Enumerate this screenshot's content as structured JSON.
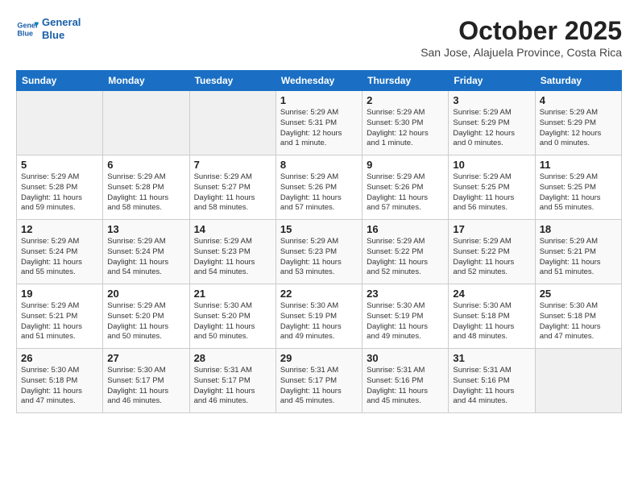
{
  "logo": {
    "line1": "General",
    "line2": "Blue"
  },
  "title": "October 2025",
  "subtitle": "San Jose, Alajuela Province, Costa Rica",
  "headers": [
    "Sunday",
    "Monday",
    "Tuesday",
    "Wednesday",
    "Thursday",
    "Friday",
    "Saturday"
  ],
  "weeks": [
    [
      {
        "day": "",
        "info": ""
      },
      {
        "day": "",
        "info": ""
      },
      {
        "day": "",
        "info": ""
      },
      {
        "day": "1",
        "info": "Sunrise: 5:29 AM\nSunset: 5:31 PM\nDaylight: 12 hours\nand 1 minute."
      },
      {
        "day": "2",
        "info": "Sunrise: 5:29 AM\nSunset: 5:30 PM\nDaylight: 12 hours\nand 1 minute."
      },
      {
        "day": "3",
        "info": "Sunrise: 5:29 AM\nSunset: 5:29 PM\nDaylight: 12 hours\nand 0 minutes."
      },
      {
        "day": "4",
        "info": "Sunrise: 5:29 AM\nSunset: 5:29 PM\nDaylight: 12 hours\nand 0 minutes."
      }
    ],
    [
      {
        "day": "5",
        "info": "Sunrise: 5:29 AM\nSunset: 5:28 PM\nDaylight: 11 hours\nand 59 minutes."
      },
      {
        "day": "6",
        "info": "Sunrise: 5:29 AM\nSunset: 5:28 PM\nDaylight: 11 hours\nand 58 minutes."
      },
      {
        "day": "7",
        "info": "Sunrise: 5:29 AM\nSunset: 5:27 PM\nDaylight: 11 hours\nand 58 minutes."
      },
      {
        "day": "8",
        "info": "Sunrise: 5:29 AM\nSunset: 5:26 PM\nDaylight: 11 hours\nand 57 minutes."
      },
      {
        "day": "9",
        "info": "Sunrise: 5:29 AM\nSunset: 5:26 PM\nDaylight: 11 hours\nand 57 minutes."
      },
      {
        "day": "10",
        "info": "Sunrise: 5:29 AM\nSunset: 5:25 PM\nDaylight: 11 hours\nand 56 minutes."
      },
      {
        "day": "11",
        "info": "Sunrise: 5:29 AM\nSunset: 5:25 PM\nDaylight: 11 hours\nand 55 minutes."
      }
    ],
    [
      {
        "day": "12",
        "info": "Sunrise: 5:29 AM\nSunset: 5:24 PM\nDaylight: 11 hours\nand 55 minutes."
      },
      {
        "day": "13",
        "info": "Sunrise: 5:29 AM\nSunset: 5:24 PM\nDaylight: 11 hours\nand 54 minutes."
      },
      {
        "day": "14",
        "info": "Sunrise: 5:29 AM\nSunset: 5:23 PM\nDaylight: 11 hours\nand 54 minutes."
      },
      {
        "day": "15",
        "info": "Sunrise: 5:29 AM\nSunset: 5:23 PM\nDaylight: 11 hours\nand 53 minutes."
      },
      {
        "day": "16",
        "info": "Sunrise: 5:29 AM\nSunset: 5:22 PM\nDaylight: 11 hours\nand 52 minutes."
      },
      {
        "day": "17",
        "info": "Sunrise: 5:29 AM\nSunset: 5:22 PM\nDaylight: 11 hours\nand 52 minutes."
      },
      {
        "day": "18",
        "info": "Sunrise: 5:29 AM\nSunset: 5:21 PM\nDaylight: 11 hours\nand 51 minutes."
      }
    ],
    [
      {
        "day": "19",
        "info": "Sunrise: 5:29 AM\nSunset: 5:21 PM\nDaylight: 11 hours\nand 51 minutes."
      },
      {
        "day": "20",
        "info": "Sunrise: 5:29 AM\nSunset: 5:20 PM\nDaylight: 11 hours\nand 50 minutes."
      },
      {
        "day": "21",
        "info": "Sunrise: 5:30 AM\nSunset: 5:20 PM\nDaylight: 11 hours\nand 50 minutes."
      },
      {
        "day": "22",
        "info": "Sunrise: 5:30 AM\nSunset: 5:19 PM\nDaylight: 11 hours\nand 49 minutes."
      },
      {
        "day": "23",
        "info": "Sunrise: 5:30 AM\nSunset: 5:19 PM\nDaylight: 11 hours\nand 49 minutes."
      },
      {
        "day": "24",
        "info": "Sunrise: 5:30 AM\nSunset: 5:18 PM\nDaylight: 11 hours\nand 48 minutes."
      },
      {
        "day": "25",
        "info": "Sunrise: 5:30 AM\nSunset: 5:18 PM\nDaylight: 11 hours\nand 47 minutes."
      }
    ],
    [
      {
        "day": "26",
        "info": "Sunrise: 5:30 AM\nSunset: 5:18 PM\nDaylight: 11 hours\nand 47 minutes."
      },
      {
        "day": "27",
        "info": "Sunrise: 5:30 AM\nSunset: 5:17 PM\nDaylight: 11 hours\nand 46 minutes."
      },
      {
        "day": "28",
        "info": "Sunrise: 5:31 AM\nSunset: 5:17 PM\nDaylight: 11 hours\nand 46 minutes."
      },
      {
        "day": "29",
        "info": "Sunrise: 5:31 AM\nSunset: 5:17 PM\nDaylight: 11 hours\nand 45 minutes."
      },
      {
        "day": "30",
        "info": "Sunrise: 5:31 AM\nSunset: 5:16 PM\nDaylight: 11 hours\nand 45 minutes."
      },
      {
        "day": "31",
        "info": "Sunrise: 5:31 AM\nSunset: 5:16 PM\nDaylight: 11 hours\nand 44 minutes."
      },
      {
        "day": "",
        "info": ""
      }
    ]
  ]
}
